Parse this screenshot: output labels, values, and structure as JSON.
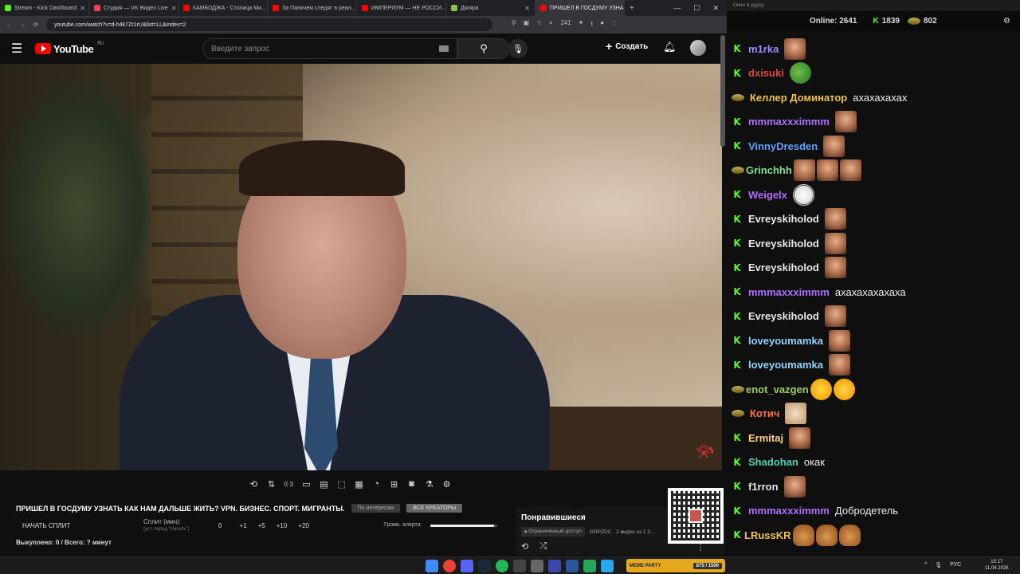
{
  "browser": {
    "tabs": [
      {
        "label": "Stream - Kick Dashboard",
        "color": "#53fc18",
        "active": false
      },
      {
        "label": "Студия — VK Видео Live",
        "color": "#ff3b5c",
        "active": false
      },
      {
        "label": "КАМБОДЖА - Столица Ми...",
        "color": "#ff0000",
        "active": false
      },
      {
        "label": "За Папичем следят в реал...",
        "color": "#ff0000",
        "active": false
      },
      {
        "label": "ИМПЕРИУМ — НЕ РОССИ...",
        "color": "#ff0000",
        "active": false
      },
      {
        "label": "Дікпіра",
        "color": "#8bc34a",
        "active": false
      },
      {
        "label": "ПРИШЕЛ В ГОСДУМУ УЗНА...",
        "color": "#ff0000",
        "active": true
      }
    ],
    "url": "youtube.com/watch?v=d-h4k7Zr1rU&list=LL&index=2",
    "badge_count": "241"
  },
  "youtube": {
    "logo_text": "YouTube",
    "region": "RU",
    "search_placeholder": "Введите запрос",
    "create_label": "Создать"
  },
  "player": {
    "controls": [
      "repeat-icon",
      "sort-icon",
      "broadcast-icon",
      "preview-icon",
      "film-icon",
      "crop-icon",
      "subtitles-icon",
      "speed-icon",
      "add-icon",
      "camera-icon",
      "flask-icon",
      "gear-icon"
    ]
  },
  "info": {
    "title": "ПРИШЕЛ В ГОСДУМУ УЗНАТЬ КАК НАМ ДАЛЬШЕ ЖИТЬ? VPN. БИЗНЕС. СПОРТ. МИГРАНТЫ.",
    "tag1": "По интересам",
    "tag2": "ВСЕ КРЕАТОРЫ",
    "split_button": "НАЧАТЬ СПЛИТ",
    "split_label": "Сплит (мин):",
    "split_hint": "(уст. перед \"Начать\")",
    "split_values": [
      "0",
      "+1",
      "+5",
      "+10",
      "+20"
    ],
    "volume_label": "Громк. алерта:",
    "volume_level": 0.95,
    "bought": "Выкуплено: 0 / Всего: ? минут"
  },
  "liked": {
    "title": "Понравившиеся",
    "access": "Ограниченный доступ",
    "meta": "GRPZDC · 2 видео из 1 2..."
  },
  "chat": {
    "header": "Окно в дурку",
    "online_label": "Online:",
    "online_count": "2641",
    "kick_count": "1839",
    "other_count": "802",
    "messages": [
      {
        "user": "m1rka",
        "color": "#9b8cff",
        "badge": "k",
        "text": "",
        "emotes": [
          "face"
        ]
      },
      {
        "user": "dxisuki",
        "color": "#e0463a",
        "badge": "k",
        "text": "",
        "emotes": [
          "pepe"
        ]
      },
      {
        "user": "Келлер Доминатор",
        "color": "#f0c24a",
        "badge": "o",
        "text": "ахахахахах",
        "emotes": []
      },
      {
        "user": "mmmaxxximmm",
        "color": "#b06cff",
        "badge": "k",
        "text": "",
        "emotes": [
          "face"
        ]
      },
      {
        "user": "VinnyDresden",
        "color": "#5ea0ff",
        "badge": "k",
        "text": "",
        "emotes": [
          "face"
        ]
      },
      {
        "user": "Grinchhh",
        "color": "#7fe08a",
        "badge": "o",
        "text": "",
        "emotes": [
          "face",
          "face",
          "face"
        ]
      },
      {
        "user": "Weigelx",
        "color": "#b06cff",
        "badge": "k",
        "text": "",
        "emotes": [
          "troll"
        ]
      },
      {
        "user": "Evreyskiholod",
        "color": "#e8e8e8",
        "badge": "k",
        "text": "",
        "emotes": [
          "face"
        ]
      },
      {
        "user": "Evreyskiholod",
        "color": "#e8e8e8",
        "badge": "k",
        "text": "",
        "emotes": [
          "face"
        ]
      },
      {
        "user": "Evreyskiholod",
        "color": "#e8e8e8",
        "badge": "k",
        "text": "",
        "emotes": [
          "face"
        ]
      },
      {
        "user": "mmmaxxximmm",
        "color": "#b06cff",
        "badge": "k",
        "text": "ахахахахахаха",
        "emotes": []
      },
      {
        "user": "Evreyskiholod",
        "color": "#e8e8e8",
        "badge": "k",
        "text": "",
        "emotes": [
          "face"
        ]
      },
      {
        "user": "loveyoumamka",
        "color": "#8fd3ff",
        "badge": "k",
        "text": "",
        "emotes": [
          "face"
        ]
      },
      {
        "user": "loveyoumamka",
        "color": "#8fd3ff",
        "badge": "k",
        "text": "",
        "emotes": [
          "face"
        ]
      },
      {
        "user": "enot_vazgen",
        "color": "#9ccc65",
        "badge": "o",
        "text": "",
        "emotes": [
          "cry",
          "cry"
        ]
      },
      {
        "user": "Котич",
        "color": "#ff7043",
        "badge": "o",
        "text": "",
        "emotes": [
          "cat"
        ]
      },
      {
        "user": "Ermitaj",
        "color": "#ffd27a",
        "badge": "k",
        "text": "",
        "emotes": [
          "face"
        ]
      },
      {
        "user": "Shadohan",
        "color": "#4dd0b3",
        "badge": "k",
        "text": "окак",
        "emotes": []
      },
      {
        "user": "f1rron",
        "color": "#e8e8e8",
        "badge": "k",
        "text": "",
        "emotes": [
          "face"
        ]
      },
      {
        "user": "mmmaxxximmm",
        "color": "#b06cff",
        "badge": "k",
        "text": "Добродетель",
        "emotes": []
      },
      {
        "user": "LRussKR",
        "color": "#f0c24a",
        "badge": "k",
        "text": "",
        "emotes": [
          "bear",
          "bear",
          "bear"
        ]
      }
    ]
  },
  "taskbar": {
    "meme_label": "MEME PARTY",
    "meme_count": "875 / 1500",
    "lang": "РУС",
    "time": "15:17",
    "date": "11.04.2026"
  }
}
